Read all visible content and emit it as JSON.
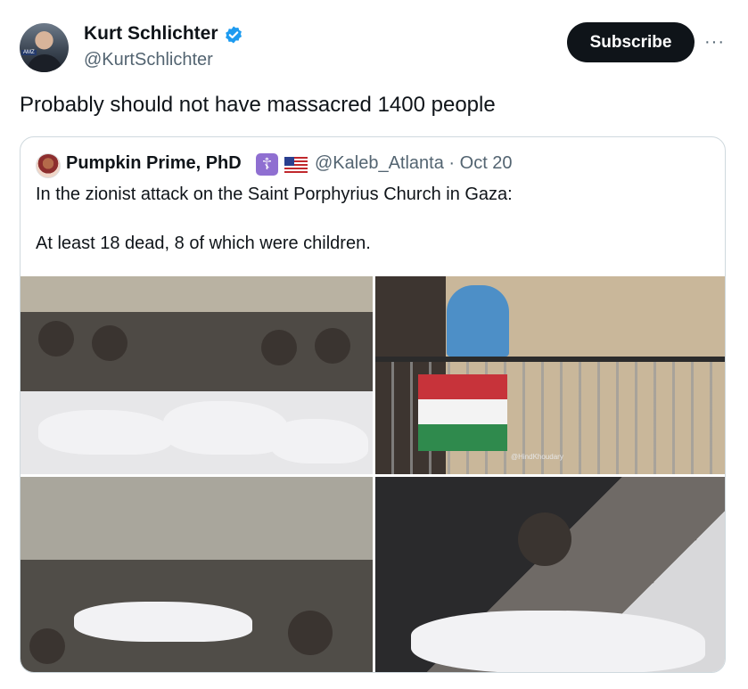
{
  "tweet": {
    "author": {
      "display_name": "Kurt Schlichter",
      "handle": "@KurtSchlichter",
      "verified": true
    },
    "subscribe_label": "Subscribe",
    "more_label": "···",
    "text": "Probably should not have massacred 1400 people"
  },
  "quoted_tweet": {
    "author": {
      "display_name": "Pumpkin Prime, PhD",
      "emoji_cross": "☦",
      "handle": "@Kaleb_Atlanta"
    },
    "meta_separator": "·",
    "date": "Oct 20",
    "line1": "In the zionist attack on the Saint Porphyrius Church in Gaza:",
    "line2": "At least 18 dead, 8 of which were children.",
    "photo_watermark": "@HindKhoudary"
  },
  "colors": {
    "verified_blue": "#1d9bf0",
    "subscribe_bg": "#0f1419",
    "muted_text": "#536471",
    "border": "#cfd9de"
  }
}
